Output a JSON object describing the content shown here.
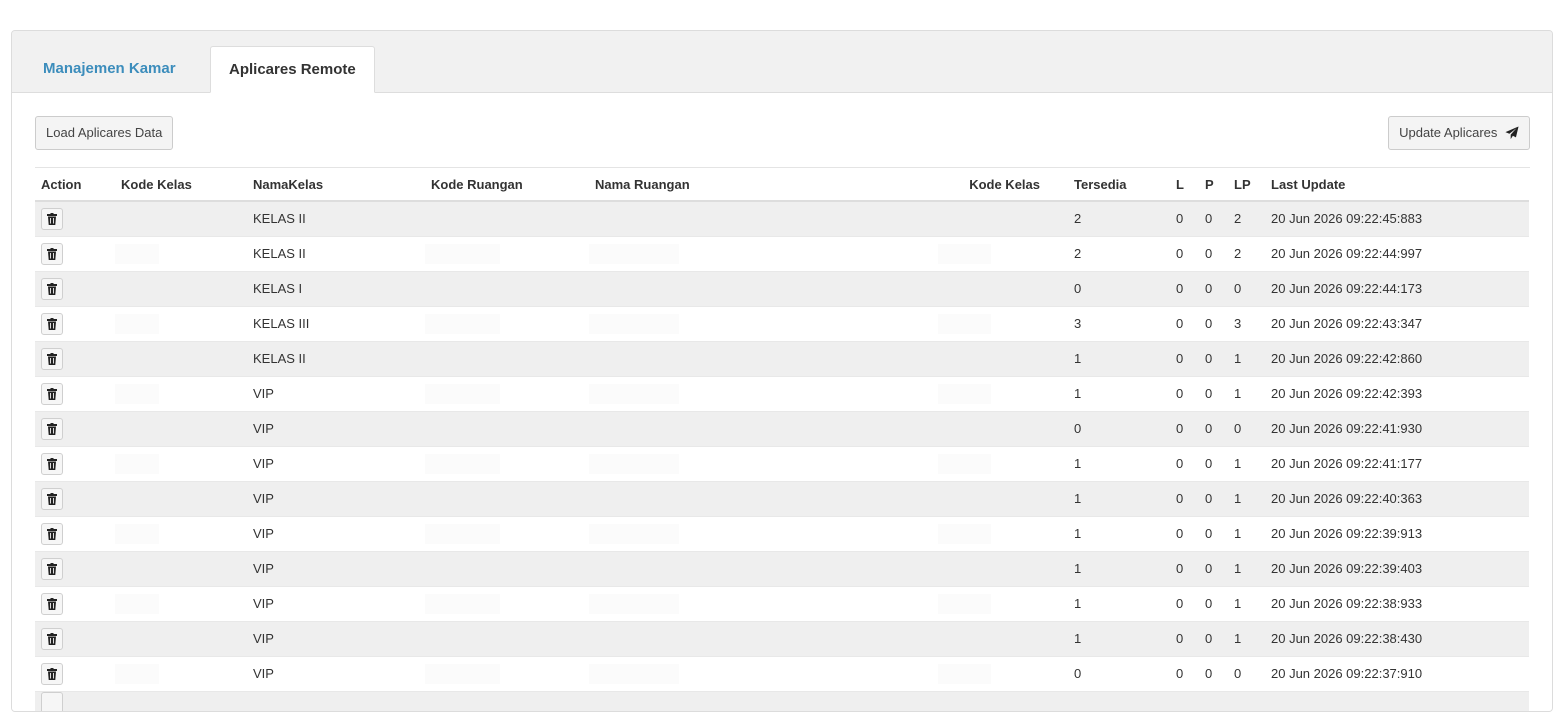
{
  "tabs": [
    {
      "label": "Manajemen Kamar",
      "active": false
    },
    {
      "label": "Aplicares Remote",
      "active": true
    }
  ],
  "toolbar": {
    "load_label": "Load Aplicares Data",
    "update_label": "Update Aplicares",
    "update_icon": "paper-plane-icon"
  },
  "table": {
    "headers": [
      "Action",
      "Kode Kelas",
      "NamaKelas",
      "Kode Ruangan",
      "Nama Ruangan",
      "Kode Kelas",
      "Tersedia",
      "L",
      "P",
      "LP",
      "Last Update"
    ],
    "action_icon": "trash-icon",
    "rows": [
      {
        "nama_kelas": "KELAS II",
        "tersedia": "2",
        "l": "0",
        "p": "0",
        "lp": "2",
        "last_update": "20 Jun 2026 09:22:45:883"
      },
      {
        "nama_kelas": "KELAS II",
        "tersedia": "2",
        "l": "0",
        "p": "0",
        "lp": "2",
        "last_update": "20 Jun 2026 09:22:44:997"
      },
      {
        "nama_kelas": "KELAS I",
        "tersedia": "0",
        "l": "0",
        "p": "0",
        "lp": "0",
        "last_update": "20 Jun 2026 09:22:44:173"
      },
      {
        "nama_kelas": "KELAS III",
        "tersedia": "3",
        "l": "0",
        "p": "0",
        "lp": "3",
        "last_update": "20 Jun 2026 09:22:43:347"
      },
      {
        "nama_kelas": "KELAS II",
        "tersedia": "1",
        "l": "0",
        "p": "0",
        "lp": "1",
        "last_update": "20 Jun 2026 09:22:42:860"
      },
      {
        "nama_kelas": "VIP",
        "tersedia": "1",
        "l": "0",
        "p": "0",
        "lp": "1",
        "last_update": "20 Jun 2026 09:22:42:393"
      },
      {
        "nama_kelas": "VIP",
        "tersedia": "0",
        "l": "0",
        "p": "0",
        "lp": "0",
        "last_update": "20 Jun 2026 09:22:41:930"
      },
      {
        "nama_kelas": "VIP",
        "tersedia": "1",
        "l": "0",
        "p": "0",
        "lp": "1",
        "last_update": "20 Jun 2026 09:22:41:177"
      },
      {
        "nama_kelas": "VIP",
        "tersedia": "1",
        "l": "0",
        "p": "0",
        "lp": "1",
        "last_update": "20 Jun 2026 09:22:40:363"
      },
      {
        "nama_kelas": "VIP",
        "tersedia": "1",
        "l": "0",
        "p": "0",
        "lp": "1",
        "last_update": "20 Jun 2026 09:22:39:913"
      },
      {
        "nama_kelas": "VIP",
        "tersedia": "1",
        "l": "0",
        "p": "0",
        "lp": "1",
        "last_update": "20 Jun 2026 09:22:39:403"
      },
      {
        "nama_kelas": "VIP",
        "tersedia": "1",
        "l": "0",
        "p": "0",
        "lp": "1",
        "last_update": "20 Jun 2026 09:22:38:933"
      },
      {
        "nama_kelas": "VIP",
        "tersedia": "1",
        "l": "0",
        "p": "0",
        "lp": "1",
        "last_update": "20 Jun 2026 09:22:38:430"
      },
      {
        "nama_kelas": "VIP",
        "tersedia": "0",
        "l": "0",
        "p": "0",
        "lp": "0",
        "last_update": "20 Jun 2026 09:22:37:910"
      }
    ]
  }
}
